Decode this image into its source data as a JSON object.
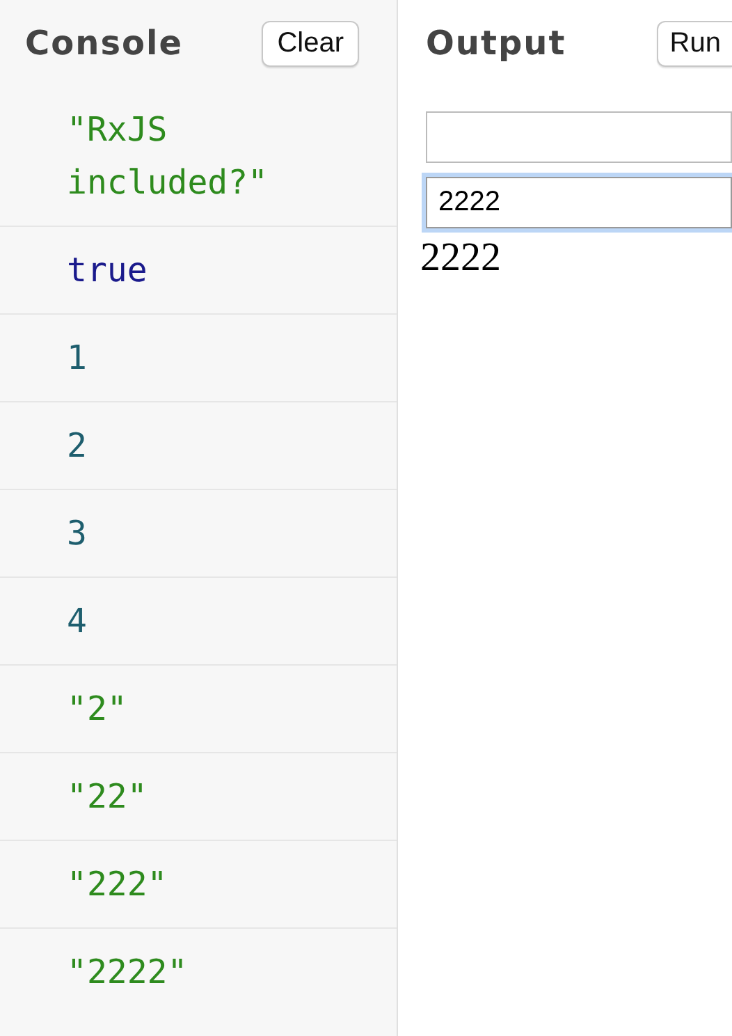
{
  "console": {
    "title": "Console",
    "clear_button": "Clear",
    "entries": [
      {
        "kind": "string",
        "text": "\"RxJS included?\""
      },
      {
        "kind": "boolean",
        "text": "true"
      },
      {
        "kind": "number",
        "text": "1"
      },
      {
        "kind": "number",
        "text": "2"
      },
      {
        "kind": "number",
        "text": "3"
      },
      {
        "kind": "number",
        "text": "4"
      },
      {
        "kind": "string",
        "text": "\"2\""
      },
      {
        "kind": "string",
        "text": "\"22\""
      },
      {
        "kind": "string",
        "text": "\"222\""
      },
      {
        "kind": "string",
        "text": "\"2222\""
      }
    ]
  },
  "output": {
    "title": "Output",
    "run_button": "Run",
    "inputs": [
      {
        "focused": false
      },
      {
        "value": "2222",
        "focused": true
      }
    ],
    "text": "2222"
  }
}
